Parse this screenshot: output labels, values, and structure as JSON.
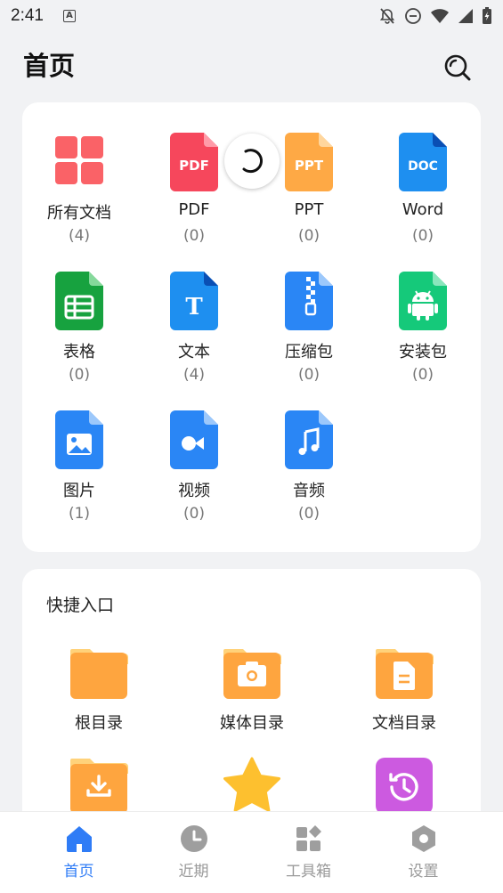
{
  "status_bar": {
    "time": "2:41"
  },
  "header": {
    "title": "首页"
  },
  "file_types": [
    {
      "label": "所有文档",
      "count": "(4)",
      "icon": "all-documents-icon"
    },
    {
      "label": "PDF",
      "count": "(0)",
      "icon": "pdf-icon",
      "badge": "PDF"
    },
    {
      "label": "PPT",
      "count": "(0)",
      "icon": "ppt-icon",
      "badge": "PPT"
    },
    {
      "label": "Word",
      "count": "(0)",
      "icon": "word-icon",
      "badge": "DOC"
    },
    {
      "label": "表格",
      "count": "(0)",
      "icon": "spreadsheet-icon"
    },
    {
      "label": "文本",
      "count": "(4)",
      "icon": "text-icon",
      "badge": "T"
    },
    {
      "label": "压缩包",
      "count": "(0)",
      "icon": "archive-icon"
    },
    {
      "label": "安装包",
      "count": "(0)",
      "icon": "android-package-icon"
    },
    {
      "label": "图片",
      "count": "(1)",
      "icon": "image-icon"
    },
    {
      "label": "视频",
      "count": "(0)",
      "icon": "video-icon"
    },
    {
      "label": "音频",
      "count": "(0)",
      "icon": "audio-icon"
    }
  ],
  "quick_access": {
    "title": "快捷入口",
    "items": [
      {
        "label": "根目录",
        "icon": "root-folder-icon"
      },
      {
        "label": "媒体目录",
        "icon": "media-folder-icon"
      },
      {
        "label": "文档目录",
        "icon": "document-folder-icon"
      },
      {
        "label": "",
        "icon": "download-folder-icon"
      },
      {
        "label": "",
        "icon": "star-icon"
      },
      {
        "label": "",
        "icon": "history-icon"
      }
    ]
  },
  "bottom_nav": [
    {
      "label": "首页",
      "icon": "home-icon",
      "active": true
    },
    {
      "label": "近期",
      "icon": "clock-icon",
      "active": false
    },
    {
      "label": "工具箱",
      "icon": "toolbox-icon",
      "active": false
    },
    {
      "label": "设置",
      "icon": "settings-icon",
      "active": false
    }
  ],
  "colors": {
    "accent": "#2f7cf6",
    "pdf": "#f6475c",
    "ppt": "#fea945",
    "word": "#1e8ff0",
    "sheet": "#17a23f",
    "android": "#15c97a",
    "folder": "#fea53f",
    "history": "#cc5ae0",
    "all_docs": "#fa6267"
  }
}
